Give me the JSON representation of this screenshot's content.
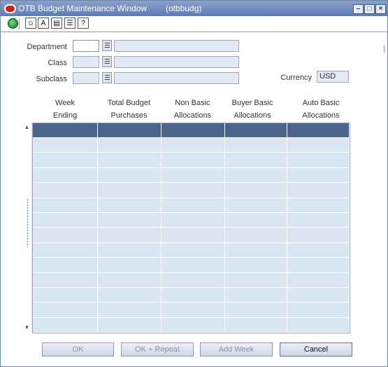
{
  "window": {
    "title": "OTB Budget Maintenance Window",
    "module": "(otbbudg)",
    "minimize_label": "–",
    "maximize_label": "□",
    "close_label": "×"
  },
  "toolbar": {
    "icons": [
      "globe-icon",
      "help-search-icon",
      "spellcheck-icon",
      "document-icon",
      "print-icon",
      "question-icon"
    ],
    "glyphs": [
      "",
      "☺",
      "A",
      "▤",
      "☰",
      "?"
    ]
  },
  "form": {
    "department_label": "Department",
    "class_label": "Class",
    "subclass_label": "Subclass",
    "currency_label": "Currency",
    "currency_value": "USD"
  },
  "columns": [
    {
      "line1": "Week",
      "line2": "Ending"
    },
    {
      "line1": "Total Budget",
      "line2": "Purchases"
    },
    {
      "line1": "Non Basic",
      "line2": "Allocations"
    },
    {
      "line1": "Buyer Basic",
      "line2": "Allocations"
    },
    {
      "line1": "Auto Basic",
      "line2": "Allocations"
    }
  ],
  "scroll": {
    "up": "▲",
    "down": "▼"
  },
  "buttons": {
    "ok": "OK",
    "ok_repeat": "OK + Repeat",
    "add_week": "Add Week",
    "cancel": "Cancel"
  }
}
